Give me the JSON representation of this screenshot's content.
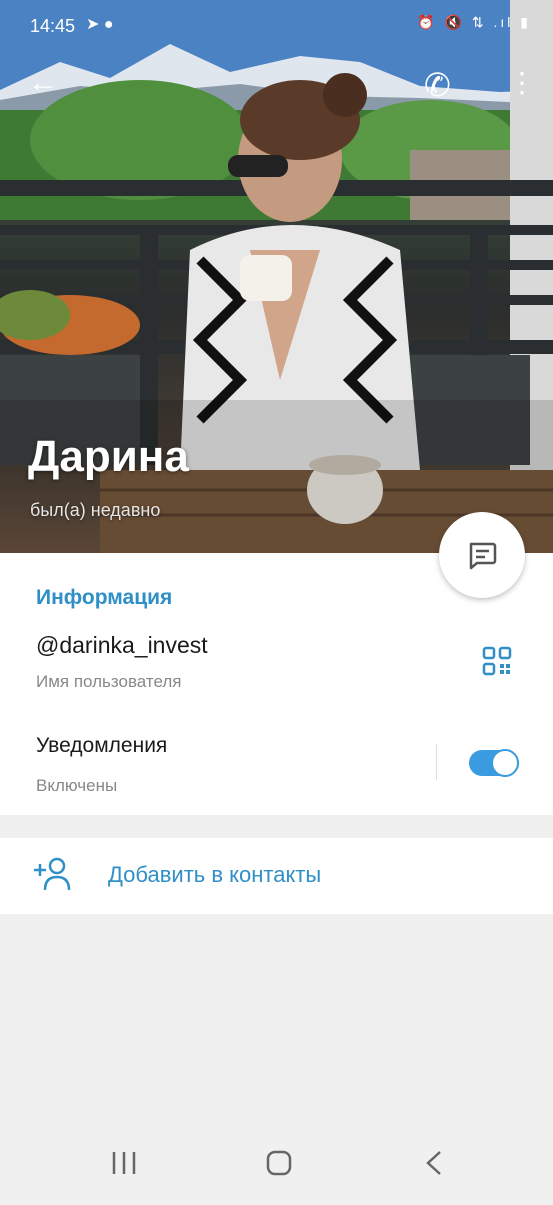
{
  "status_bar": {
    "time": "14:45",
    "left_icons": "➤ ●",
    "right_icons": "⏰ 🔇 ⇅ .ıl ▮"
  },
  "header": {
    "back_icon": "←",
    "call_icon": "✆",
    "more_icon": "⋮"
  },
  "profile": {
    "name": "Дарина",
    "status": "был(а) недавно"
  },
  "info": {
    "section_title": "Информация",
    "username": "@darinka_invest",
    "username_caption": "Имя пользователя",
    "notifications_label": "Уведомления",
    "notifications_value": "Включены",
    "notifications_on": true
  },
  "actions": {
    "add_contact": "Добавить в контакты"
  },
  "colors": {
    "accent": "#2f8fc6",
    "toggle": "#3a9be0",
    "background": "#f0f0f0"
  }
}
